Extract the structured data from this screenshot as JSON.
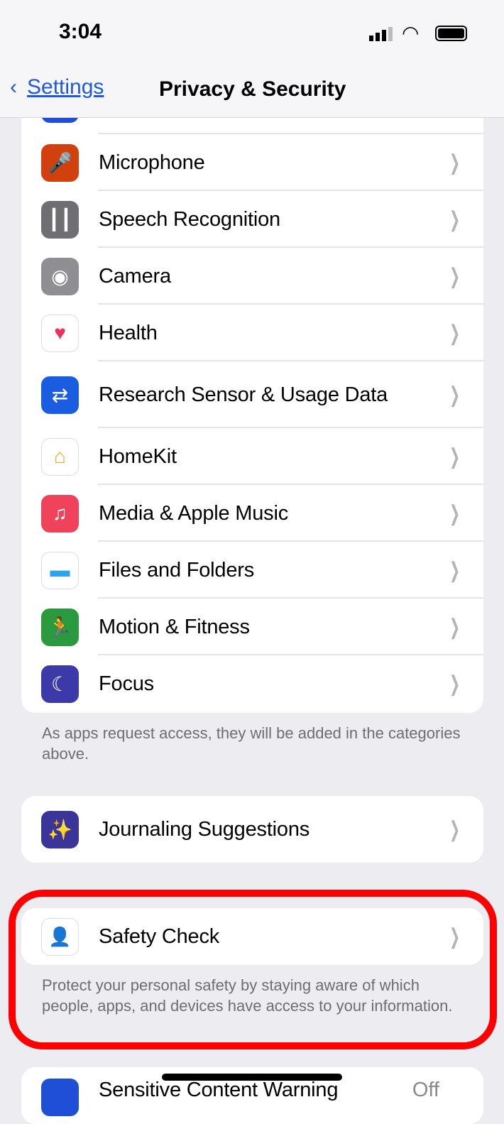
{
  "status": {
    "time": "3:04"
  },
  "nav": {
    "back": "Settings",
    "title": "Privacy & Security"
  },
  "list": [
    {
      "label": "Microphone",
      "icon": "microphone-icon",
      "color": "#d2400e"
    },
    {
      "label": "Speech Recognition",
      "icon": "waveform-icon",
      "color": "#6e6e73"
    },
    {
      "label": "Camera",
      "icon": "camera-icon",
      "color": "#8e8e93"
    },
    {
      "label": "Health",
      "icon": "heart-icon",
      "color": "#ffffff"
    },
    {
      "label": "Research Sensor & Usage Data",
      "icon": "research-icon",
      "color": "#1a5de0"
    },
    {
      "label": "HomeKit",
      "icon": "home-icon",
      "color": "#ffffff"
    },
    {
      "label": "Media & Apple Music",
      "icon": "music-note-icon",
      "color": "#f0425a"
    },
    {
      "label": "Files and Folders",
      "icon": "folder-icon",
      "color": "#ffffff"
    },
    {
      "label": "Motion & Fitness",
      "icon": "running-figure-icon",
      "color": "#2b9a3e"
    },
    {
      "label": "Focus",
      "icon": "moon-icon",
      "color": "#3c3aa8"
    }
  ],
  "list_footer": "As apps request access, they will be added in the categories above.",
  "journaling": {
    "label": "Journaling Suggestions"
  },
  "safety": {
    "label": "Safety Check",
    "footer": "Protect your personal safety by staying aware of which people, apps, and devices have access to your information."
  },
  "sensitive": {
    "label": "Sensitive Content Warning",
    "value": "Off"
  },
  "highlight_color": "#ff0000"
}
